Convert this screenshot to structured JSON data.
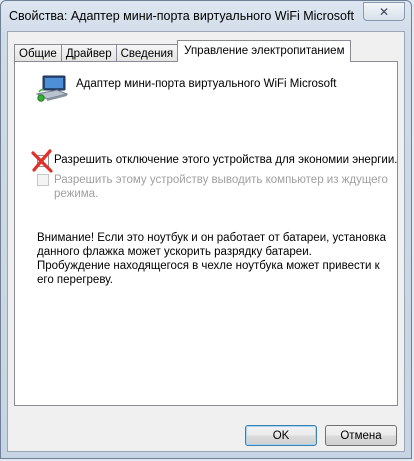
{
  "window": {
    "title": "Свойства: Адаптер мини-порта виртуального WiFi Microsoft",
    "close_glyph": "✕"
  },
  "tabs": [
    {
      "label": "Общие"
    },
    {
      "label": "Драйвер"
    },
    {
      "label": "Сведения"
    },
    {
      "label": "Управление электропитанием"
    }
  ],
  "device": {
    "name": "Адаптер мини-порта виртуального WiFi Microsoft",
    "icon": "network-adapter-icon"
  },
  "options": {
    "allow_turn_off": {
      "label": "Разрешить отключение этого устройства для экономии энергии.",
      "checked": false,
      "enabled": true
    },
    "allow_wake": {
      "label_line1": "Разрешить этому устройству выводить компьютер из ждущего",
      "label_line2": "режима.",
      "checked": false,
      "enabled": false
    }
  },
  "warning": {
    "text": "Внимание! Если это ноутбук и он работает от батареи, установка данного флажка может ускорить разрядку батареи. Пробуждение находящегося в чехле ноутбука может привести к его перегреву."
  },
  "buttons": {
    "ok": "OK",
    "cancel": "Отмена"
  },
  "colors": {
    "annotation_mark": "#e0302a",
    "disabled_text": "#a0a0a0"
  }
}
